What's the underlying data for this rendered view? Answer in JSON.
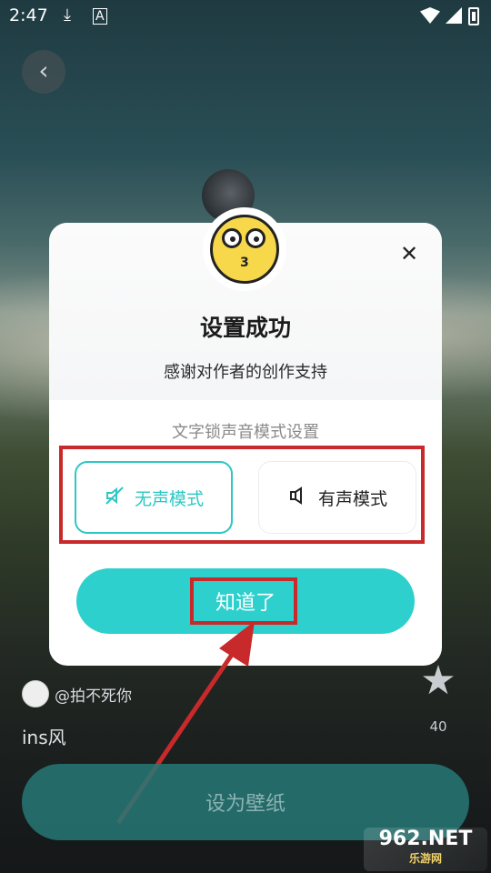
{
  "status_bar": {
    "time": "2:47",
    "icons": [
      "download-icon",
      "a-icon",
      "wifi-icon",
      "signal-icon",
      "battery-icon"
    ]
  },
  "back": {
    "label": "‹"
  },
  "modal": {
    "title": "设置成功",
    "subtitle": "感谢对作者的创作支持",
    "section_label": "文字锁声音模式设置",
    "modes": [
      {
        "label": "无声模式",
        "selected": true
      },
      {
        "label": "有声模式",
        "selected": false
      }
    ],
    "confirm_label": "知道了",
    "close_label": "✕"
  },
  "wallpaper": {
    "author": "@拍不死你",
    "style": "ins风",
    "likes": "40",
    "set_label": "设为壁纸"
  },
  "watermark": {
    "main": "962.NET",
    "sub": "乐游网"
  },
  "colors": {
    "accent": "#2dd0cc",
    "annotation": "#c8292a"
  }
}
